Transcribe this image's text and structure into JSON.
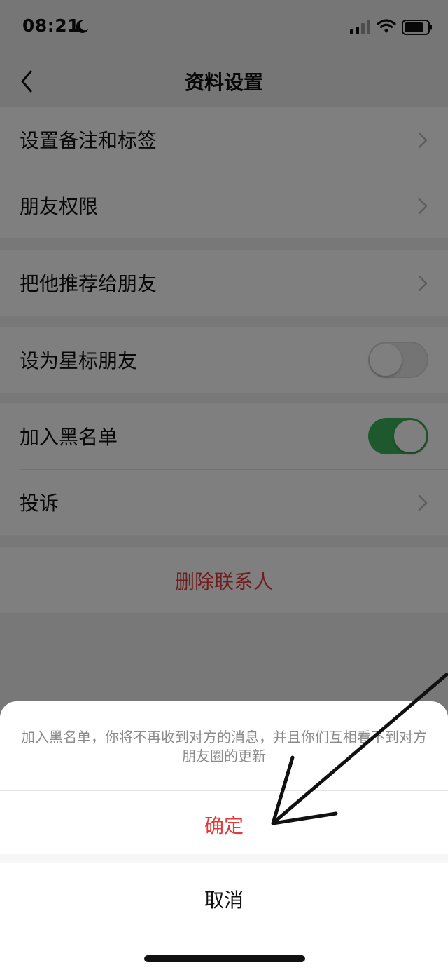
{
  "status_bar": {
    "time": "08:21",
    "icons": [
      "moon-icon",
      "signal-icon",
      "wifi-icon",
      "battery-icon"
    ]
  },
  "nav": {
    "title": "资料设置",
    "back_icon": "chevron-left-icon"
  },
  "groups": [
    {
      "rows": [
        {
          "label": "设置备注和标签",
          "type": "chevron"
        },
        {
          "label": "朋友权限",
          "type": "chevron"
        }
      ]
    },
    {
      "rows": [
        {
          "label": "把他推荐给朋友",
          "type": "chevron"
        }
      ]
    },
    {
      "rows": [
        {
          "label": "设为星标朋友",
          "type": "toggle",
          "on": false
        }
      ]
    },
    {
      "rows": [
        {
          "label": "加入黑名单",
          "type": "toggle",
          "on": true
        },
        {
          "label": "投诉",
          "type": "chevron"
        }
      ]
    }
  ],
  "delete_contact": {
    "label": "删除联系人"
  },
  "action_sheet": {
    "message": "加入黑名单，你将不再收到对方的消息，并且你们互相看不到对方朋友圈的更新",
    "confirm_label": "确定",
    "cancel_label": "取消"
  },
  "colors": {
    "danger": "#e23a3a",
    "toggle_on": "#3db25c",
    "toggle_off": "#e9e9e9",
    "page_background": "#f1f1f1",
    "overlay": "rgba(0,0,0,0.5)"
  }
}
